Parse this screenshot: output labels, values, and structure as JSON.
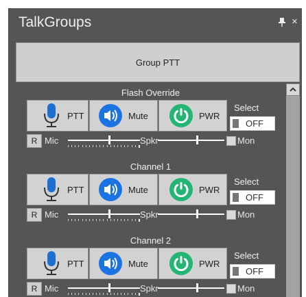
{
  "window": {
    "title": "TalkGroups",
    "close_glyph": "×"
  },
  "group_ptt_label": "Group PTT",
  "icons": {
    "pin": "pin-icon",
    "close": "close-icon",
    "ptt": "microphone-icon",
    "mute": "speaker-icon",
    "pwr": "power-icon",
    "scroll_up": "chevron-up-icon"
  },
  "colors": {
    "mic_blue": "#1f6fd1",
    "speaker_blue": "#1a73e0",
    "power_green": "#22b573"
  },
  "channels": [
    {
      "name": "Flash Override",
      "ptt_label": "PTT",
      "mute_label": "Mute",
      "pwr_label": "PWR",
      "select_label": "Select",
      "select_state": "OFF",
      "reset_label": "R",
      "mic_label": "Mic",
      "spkr_label": "Spkr",
      "mon_label": "Mon",
      "mic_level": 0.58,
      "spkr_level": 0.6,
      "mon_checked": false
    },
    {
      "name": "Channel 1",
      "ptt_label": "PTT",
      "mute_label": "Mute",
      "pwr_label": "PWR",
      "select_label": "Select",
      "select_state": "OFF",
      "reset_label": "R",
      "mic_label": "Mic",
      "spkr_label": "Spkr",
      "mon_label": "Mon",
      "mic_level": 0.58,
      "spkr_level": 0.6,
      "mon_checked": false
    },
    {
      "name": "Channel 2",
      "ptt_label": "PTT",
      "mute_label": "Mute",
      "pwr_label": "PWR",
      "select_label": "Select",
      "select_state": "OFF",
      "reset_label": "R",
      "mic_label": "Mic",
      "spkr_label": "Spkr",
      "mon_label": "Mon",
      "mic_level": 0.58,
      "spkr_level": 0.6,
      "mon_checked": false
    }
  ]
}
